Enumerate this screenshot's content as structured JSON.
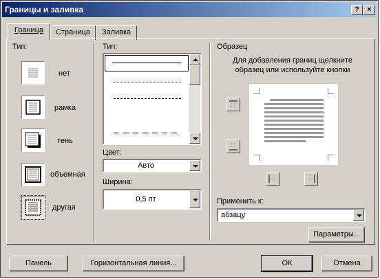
{
  "window": {
    "title": "Границы и заливка",
    "help_button": "?",
    "close_button": "×"
  },
  "tabs": [
    {
      "label": "Граница",
      "active": true
    },
    {
      "label": "Страница",
      "active": false
    },
    {
      "label": "Заливка",
      "active": false
    }
  ],
  "settings": {
    "label": "Тип:",
    "items": [
      {
        "label": "нет",
        "icon": "border-none-icon"
      },
      {
        "label": "рамка",
        "icon": "border-box-icon"
      },
      {
        "label": "тень",
        "icon": "border-shadow-icon"
      },
      {
        "label": "объемная",
        "icon": "border-3d-icon"
      },
      {
        "label": "другая",
        "icon": "border-custom-icon",
        "selected": true
      }
    ]
  },
  "style": {
    "label": "Тип:",
    "line_styles": [
      "solid",
      "dotted",
      "dash-small",
      "dash-medium",
      "dash-large"
    ]
  },
  "color": {
    "label": "Цвет:",
    "value": "Авто"
  },
  "width": {
    "label": "Ширина:",
    "value": "0,5 пт"
  },
  "preview": {
    "title": "Образец",
    "hint": "Для добавления границ щелкните образец или используйте кнопки"
  },
  "apply_to": {
    "label": "Применить к:",
    "value": "абзацу"
  },
  "buttons": {
    "options": "Параметры...",
    "toolbar": "Панель",
    "horizontal_line": "Горизонтальная линия...",
    "ok": "ОК",
    "cancel": "Отмена"
  },
  "colors": {
    "titlebar_start": "#0a246a",
    "titlebar_end": "#a6caf0",
    "face": "#d4d0c8"
  }
}
